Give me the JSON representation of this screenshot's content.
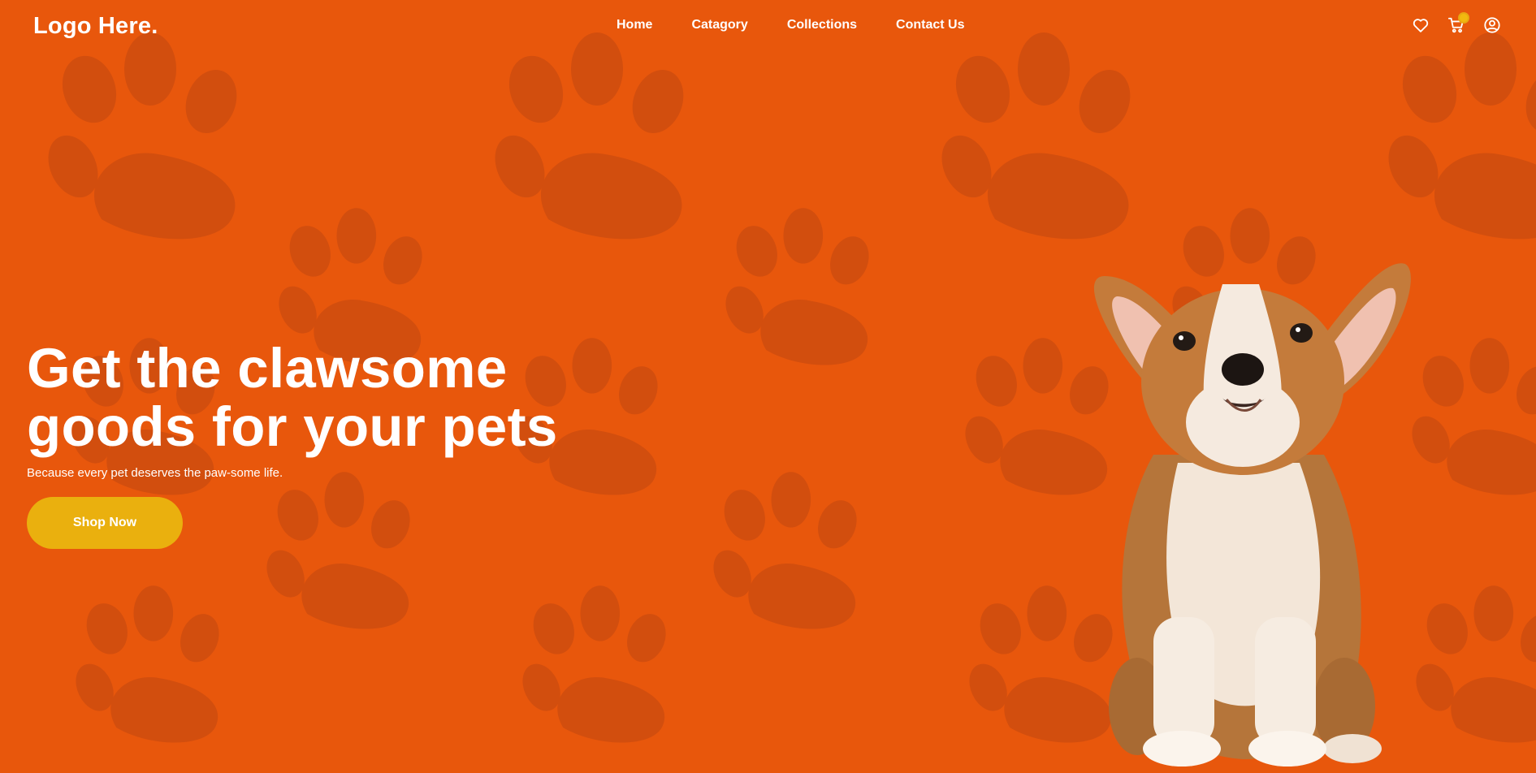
{
  "header": {
    "logo": "Logo Here.",
    "nav": [
      "Home",
      "Catagory",
      "Collections",
      "Contact Us"
    ],
    "icons": [
      "heart-icon",
      "cart-icon",
      "user-icon"
    ]
  },
  "hero": {
    "title_line1": "Get the clawsome",
    "title_line2": "goods for your pets",
    "subtitle": "Because every pet deserves the paw-some life.",
    "button_label": "Shop Now"
  },
  "colors": {
    "background": "#e8570c",
    "paw": "#cf4d0f",
    "button": "#eab00e",
    "badge": "#f2b90f",
    "text": "#ffffff"
  }
}
